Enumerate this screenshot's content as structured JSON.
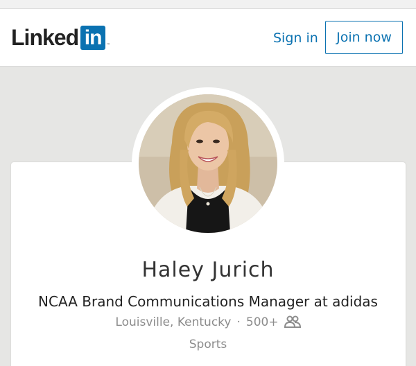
{
  "header": {
    "logo_text": "Linked",
    "logo_box_text": "in",
    "logo_tm": "™",
    "signin_label": "Sign in",
    "join_label": "Join now",
    "brand_color": "#0b72b1"
  },
  "profile": {
    "name": "Haley Jurich",
    "headline": "NCAA Brand Communications Manager at adidas",
    "location": "Louisville, Kentucky",
    "separator": "·",
    "connections": "500+",
    "connections_icon": "people-icon",
    "industry": "Sports"
  }
}
